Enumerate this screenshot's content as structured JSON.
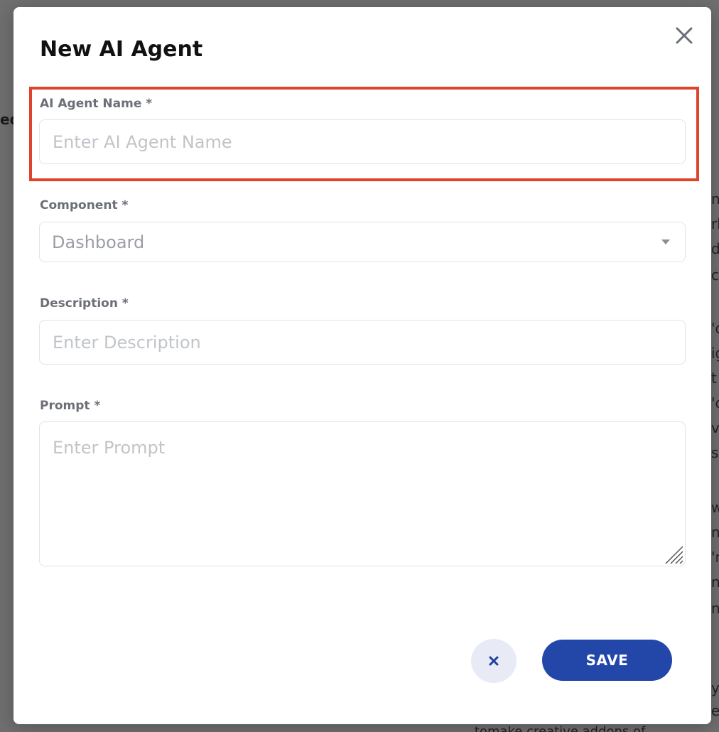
{
  "background": {
    "left_fragment": "ed",
    "right_fragments": [
      "n",
      "rk",
      "d",
      "c",
      "'c",
      "ig",
      "t",
      "'c",
      "v",
      "s",
      "w",
      "n",
      "'r",
      "n",
      "n",
      "y",
      "er"
    ],
    "bottom_fragment": "... tomake creative addons of ..."
  },
  "modal": {
    "title": "New AI Agent",
    "close_icon": "close-icon",
    "fields": {
      "name": {
        "label": "AI Agent Name *",
        "placeholder": "Enter AI Agent Name",
        "value": ""
      },
      "component": {
        "label": "Component *",
        "value": "Dashboard"
      },
      "description": {
        "label": "Description *",
        "placeholder": "Enter Description",
        "value": ""
      },
      "prompt": {
        "label": "Prompt *",
        "placeholder": "Enter Prompt",
        "value": ""
      }
    },
    "buttons": {
      "cancel_icon": "x-icon",
      "save_label": "SAVE"
    }
  },
  "colors": {
    "highlight": "#e0432c",
    "save_button": "#2346a9",
    "cancel_button_bg": "#e8ebf5",
    "cancel_icon": "#1f3f9e"
  }
}
